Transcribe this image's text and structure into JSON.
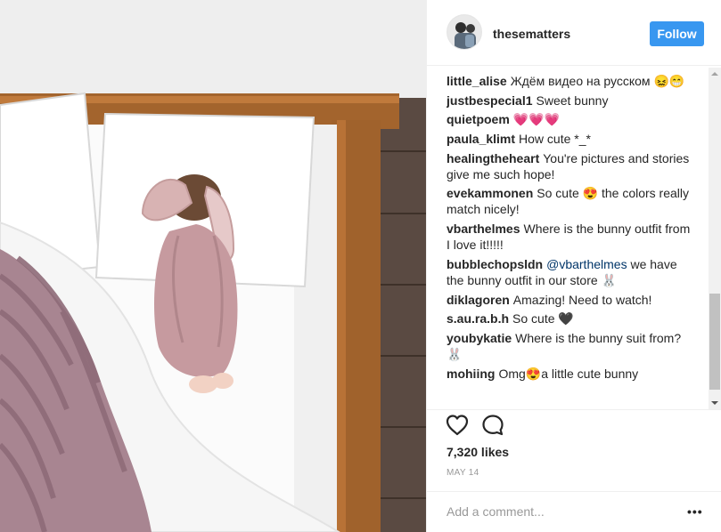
{
  "post": {
    "photo_alt": "Baby in bunny outfit sleeping on bed",
    "username": "thesematters",
    "follow_label": "Follow",
    "comments": [
      {
        "user": "little_alise",
        "text": "Ждём видео на русском 😖😁"
      },
      {
        "user": "justbespecial1",
        "text": "Sweet bunny"
      },
      {
        "user": "quietpoem",
        "text": "💗💗💗"
      },
      {
        "user": "paula_klimt",
        "text": "How cute *_*"
      },
      {
        "user": "healingtheheart",
        "text": "You're pictures and stories give me such hope!"
      },
      {
        "user": "evekammonen",
        "text": "So cute 😍 the colors really match nicely!"
      },
      {
        "user": "vbarthelmes",
        "text": "Where is the bunny outfit from I love it!!!!!"
      },
      {
        "user": "bubblechopsldn",
        "mention": "@vbarthelmes",
        "text": "we have the bunny outfit in our store 🐰"
      },
      {
        "user": "diklagoren",
        "text": "Amazing! Need to watch!"
      },
      {
        "user": "s.au.ra.b.h",
        "text": "So cute 🖤"
      },
      {
        "user": "youbykatie",
        "text": "Where is the bunny suit from? 🐰"
      },
      {
        "user": "mohiing",
        "text": "Omg😍a little cute bunny"
      }
    ],
    "likes": "7,320 likes",
    "date": "MAY 14",
    "add_comment_placeholder": "Add a comment...",
    "more_label": "•••"
  },
  "icons": {
    "like": "heart-outline-icon",
    "comment": "speech-bubble-icon",
    "more": "ellipsis-icon"
  },
  "colors": {
    "follow_button": "#3897f0",
    "mention": "#003569",
    "muted": "#999999"
  }
}
